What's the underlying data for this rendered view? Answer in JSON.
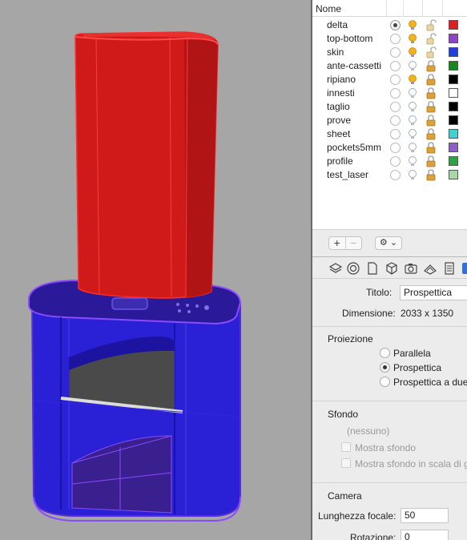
{
  "layers_panel": {
    "name_column": "Nome",
    "layers": [
      {
        "name": "delta",
        "current": true,
        "on": true,
        "locked": false,
        "color": "#e02020"
      },
      {
        "name": "top-bottom",
        "current": false,
        "on": true,
        "locked": false,
        "color": "#8e44c4"
      },
      {
        "name": "skin",
        "current": false,
        "on": true,
        "locked": false,
        "color": "#1f3de0"
      },
      {
        "name": "ante-cassetti",
        "current": false,
        "on": false,
        "locked": true,
        "color": "#138a1f"
      },
      {
        "name": "ripiano",
        "current": false,
        "on": true,
        "locked": true,
        "color": "#000000"
      },
      {
        "name": "innesti",
        "current": false,
        "on": false,
        "locked": true,
        "color": "#ffffff"
      },
      {
        "name": "taglio",
        "current": false,
        "on": false,
        "locked": true,
        "color": "#000000"
      },
      {
        "name": "prove",
        "current": false,
        "on": false,
        "locked": true,
        "color": "#000000"
      },
      {
        "name": "sheet",
        "current": false,
        "on": false,
        "locked": true,
        "color": "#3fd2d2"
      },
      {
        "name": "pockets5mm",
        "current": false,
        "on": false,
        "locked": true,
        "color": "#8d5fc9"
      },
      {
        "name": "profile",
        "current": false,
        "on": false,
        "locked": true,
        "color": "#34a046"
      },
      {
        "name": "test_laser",
        "current": false,
        "on": false,
        "locked": true,
        "color": "#a6d9a6"
      }
    ],
    "toolbar": {
      "add": "+",
      "remove": "−",
      "gear": "⚙ ⌄"
    }
  },
  "tabs": [
    "layers-icon",
    "material-icon",
    "document-icon",
    "object-icon",
    "camera-icon",
    "render-icon",
    "notes-icon",
    "help-icon"
  ],
  "properties": {
    "titolo_label": "Titolo:",
    "titolo_value": "Prospettica",
    "dimensione_label": "Dimensione:",
    "dimensione_value": "2033 x 1350",
    "proiezione_heading": "Proiezione",
    "proiezione_options": [
      "Parallela",
      "Prospettica",
      "Prospettica a due"
    ],
    "proiezione_selected": "Prospettica",
    "sfondo_heading": "Sfondo",
    "sfondo_value": "(nessuno)",
    "mostra_sfondo": "Mostra sfondo",
    "mostra_sfondo_scala": "Mostra sfondo in scala di g",
    "camera_heading": "Camera",
    "lunghezza_label": "Lunghezza focale:",
    "lunghezza_value": "50",
    "rotazione_label": "Rotazione:",
    "rotazione_value": "0"
  }
}
